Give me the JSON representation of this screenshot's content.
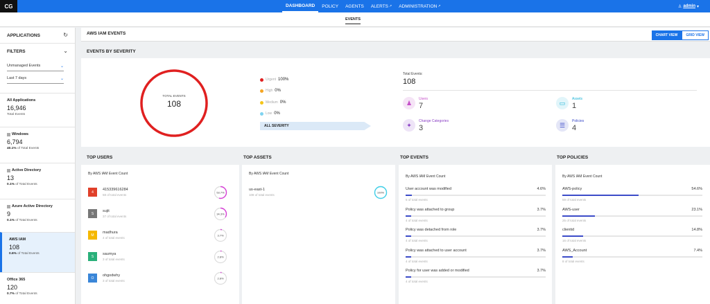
{
  "app": {
    "logo": "CG"
  },
  "nav": {
    "items": [
      {
        "label": "DASHBOARD",
        "active": true,
        "ext": false
      },
      {
        "label": "POLICY",
        "active": false,
        "ext": false
      },
      {
        "label": "AGENTS",
        "active": false,
        "ext": false
      },
      {
        "label": "ALERTS",
        "active": false,
        "ext": true
      },
      {
        "label": "ADMINISTRATION",
        "active": false,
        "ext": true
      }
    ],
    "user": "admin"
  },
  "subnav": {
    "tab": "EVENTS"
  },
  "sidebar": {
    "applications_title": "APPLICATIONS",
    "filters_title": "FILTERS",
    "filter1": "Unmanaged Events",
    "filter2": "Last 7 days",
    "apps": [
      {
        "name": "All Applications",
        "count": "16,946",
        "sub_pct": "",
        "sub_text": "Total Events",
        "active": false
      },
      {
        "name": "Windows",
        "count": "6,794",
        "sub_pct": "40.1%",
        "sub_text": " of Total Events",
        "active": false
      },
      {
        "name": "Active Directory",
        "count": "13",
        "sub_pct": "0.1%",
        "sub_text": " of Total Events",
        "active": false
      },
      {
        "name": "Azure Active Directory",
        "count": "9",
        "sub_pct": "0.1%",
        "sub_text": " of Total Events",
        "active": false
      },
      {
        "name": "AWS IAM",
        "count": "108",
        "sub_pct": "0.6%",
        "sub_text": " of Total Events",
        "active": true
      },
      {
        "name": "Office 365",
        "count": "120",
        "sub_pct": "0.7%",
        "sub_text": " of Total Events",
        "active": false
      }
    ]
  },
  "main": {
    "title": "AWS IAM EVENTS",
    "chart_view": "CHART VIEW",
    "grid_view": "GRID VIEW",
    "severity_title": "EVENTS BY SEVERITY"
  },
  "severity": {
    "total_label": "TOTAL EVENTS",
    "total_value": "108",
    "items": [
      {
        "name": "Urgent",
        "value": "100%",
        "color": "#e02020"
      },
      {
        "name": "High",
        "value": "0%",
        "color": "#f5a623"
      },
      {
        "name": "Medium",
        "value": "0%",
        "color": "#f5c518"
      },
      {
        "name": "Low",
        "value": "0%",
        "color": "#7fd3f0"
      }
    ],
    "all_label": "ALL SEVERITY"
  },
  "totals": {
    "label": "Total Events:",
    "value": "108",
    "stats": [
      {
        "label": "Users",
        "value": "7",
        "icon": "user-icon",
        "color": "#c44dc8",
        "bg": "#f5e4f6"
      },
      {
        "label": "Assets",
        "value": "1",
        "icon": "monitor-icon",
        "color": "#1ab3d6",
        "bg": "#e1f5fa"
      },
      {
        "label": "Change Categories",
        "value": "3",
        "icon": "categories-icon",
        "color": "#8a3fc4",
        "bg": "#eee4f7"
      },
      {
        "label": "Policies",
        "value": "4",
        "icon": "policy-icon",
        "color": "#3b4bc8",
        "bg": "#e4e6f7"
      }
    ]
  },
  "top_users": {
    "title": "TOP USERS",
    "subtitle": "By AWS IAM Event Count",
    "items": [
      {
        "initial": "4",
        "name": "415339616284",
        "sub": "58 of total events",
        "pct": "53.7%",
        "frac": 0.537,
        "color": "#e0402a"
      },
      {
        "initial": "S",
        "name": "sujit",
        "sub": "37 of total events",
        "pct": "34.3%",
        "frac": 0.343,
        "color": "#777"
      },
      {
        "initial": "M",
        "name": "madhura",
        "sub": "4 of total events",
        "pct": "3.7%",
        "frac": 0.037,
        "color": "#f5b800"
      },
      {
        "initial": "S",
        "name": "saumya",
        "sub": "3 of total events",
        "pct": "2.8%",
        "frac": 0.028,
        "color": "#2ab07a"
      },
      {
        "initial": "O",
        "name": "ohgodwhy",
        "sub": "3 of total events",
        "pct": "2.8%",
        "frac": 0.028,
        "color": "#3a86d8"
      }
    ]
  },
  "top_assets": {
    "title": "TOP ASSETS",
    "subtitle": "By AWS IAM Event Count",
    "items": [
      {
        "name": "us-east-1",
        "sub": "108 of total events",
        "pct": "100%",
        "frac": 1.0
      }
    ]
  },
  "top_events": {
    "title": "TOP EVENTS",
    "subtitle": "By AWS IAM Event Count",
    "items": [
      {
        "name": "User account was modified",
        "pct": "4.6%",
        "frac": 0.046,
        "sub": "5 of total events"
      },
      {
        "name": "Policy was attached to group",
        "pct": "3.7%",
        "frac": 0.037,
        "sub": "4 of total events"
      },
      {
        "name": "Policy was detached from role",
        "pct": "3.7%",
        "frac": 0.037,
        "sub": "4 of total events"
      },
      {
        "name": "Policy was attached to user account",
        "pct": "3.7%",
        "frac": 0.037,
        "sub": "4 of total events"
      },
      {
        "name": "Policy for user was added or modified",
        "pct": "3.7%",
        "frac": 0.037,
        "sub": "4 of total events"
      }
    ]
  },
  "top_policies": {
    "title": "TOP POLICIES",
    "subtitle": "By AWS IAM Event Count",
    "items": [
      {
        "name": "AWS-policy",
        "pct": "54.6%",
        "frac": 0.546,
        "sub": "59 of total events"
      },
      {
        "name": "AWS-user",
        "pct": "23.1%",
        "frac": 0.231,
        "sub": "25 of total events"
      },
      {
        "name": "clientid",
        "pct": "14.8%",
        "frac": 0.148,
        "sub": "16 of total events"
      },
      {
        "name": "AWS_Account",
        "pct": "7.4%",
        "frac": 0.074,
        "sub": "8 of total events"
      }
    ]
  }
}
